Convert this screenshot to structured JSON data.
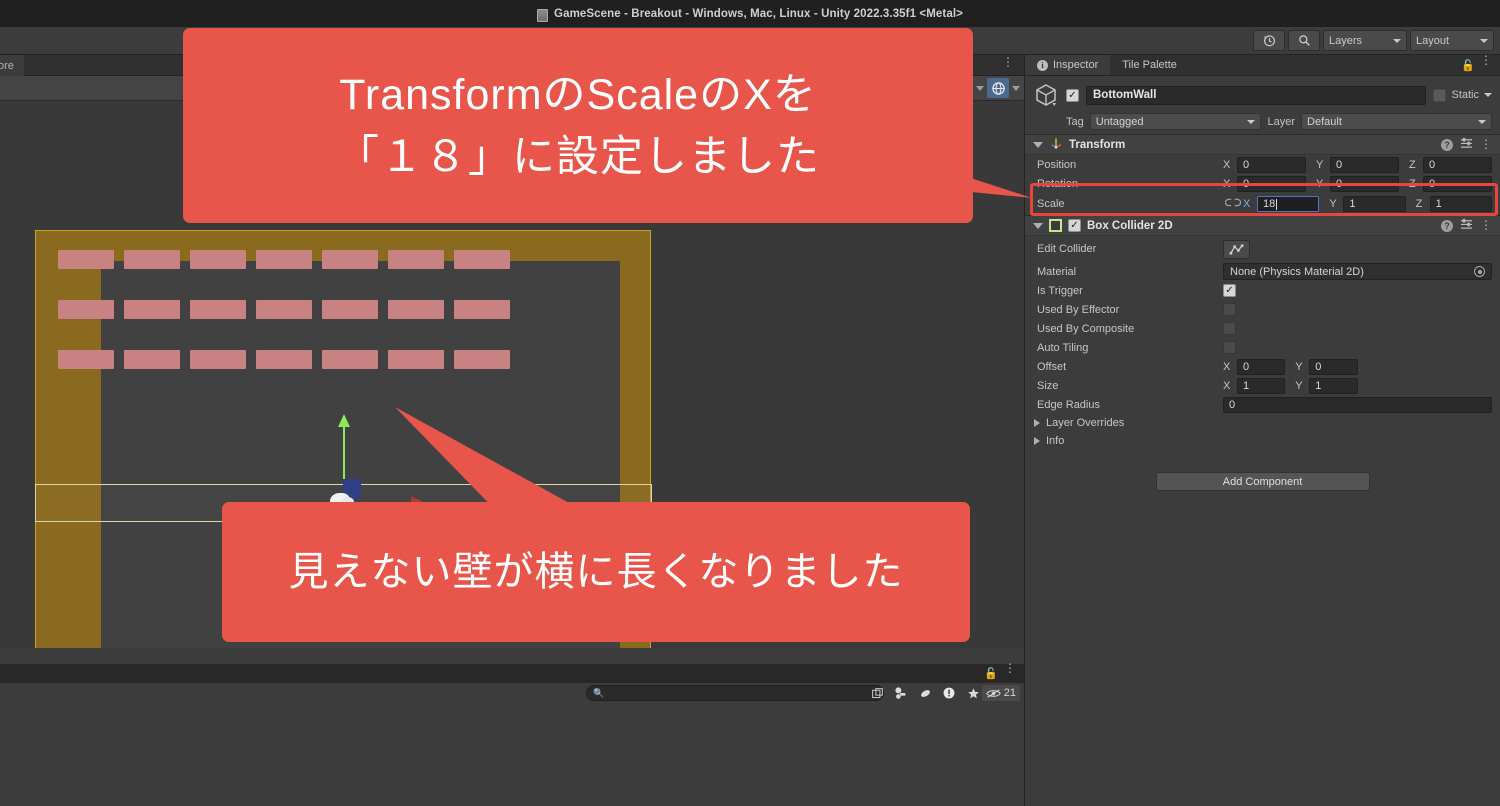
{
  "window": {
    "title": "GameScene - Breakout - Windows, Mac, Linux - Unity 2022.3.35f1 <Metal>",
    "icon": "unity-scene-icon"
  },
  "toolbar": {
    "history_icon": "history-clock-icon",
    "search_icon": "search-icon",
    "layers_label": "Layers",
    "layout_label": "Layout"
  },
  "scene": {
    "tab_partial_label": "ore",
    "kebab": "⋮",
    "pivot_icon": "globe-icon",
    "bricks_rows": 3,
    "bricks_per_row": 7,
    "selected_object_label": "BottomWall",
    "gizmo": {
      "x_axis_color": "#b03a30",
      "y_axis_color": "#8aea5a",
      "z_axis_color": "#2f3f86"
    },
    "wall_color": "#8a6a1e",
    "brick_color": "#c98282",
    "background_color": "#414141"
  },
  "project_bar": {
    "search_placeholder": "",
    "lock_icon": "lock-open-icon",
    "kebab_icon": "kebab-menu-icon",
    "tools": [
      "new-folder-icon",
      "label-icon",
      "alert-icon",
      "favorite-star-icon"
    ],
    "visibility_count": "21"
  },
  "inspector": {
    "tabs": [
      {
        "label": "Inspector",
        "icon": "info-icon",
        "active": true
      },
      {
        "label": "Tile Palette",
        "icon": "",
        "active": false
      }
    ],
    "lock_icon": "lock-open-icon",
    "kebab_icon": "kebab-menu-icon",
    "gameobject": {
      "icon": "cube-icon",
      "enabled": true,
      "name": "BottomWall",
      "static_label": "Static",
      "static_checked": false,
      "tag_label": "Tag",
      "tag_value": "Untagged",
      "layer_label": "Layer",
      "layer_value": "Default"
    },
    "transform": {
      "title": "Transform",
      "icon": "transform-axis-icon",
      "help_icon": "help-icon",
      "preset_icon": "preset-icon",
      "kebab_icon": "kebab-menu-icon",
      "rows": [
        {
          "label": "Position",
          "x": "0",
          "y": "0",
          "z": "0"
        },
        {
          "label": "Rotation",
          "x": "0",
          "y": "0",
          "z": "0"
        },
        {
          "label": "Scale",
          "x": "18",
          "y": "1",
          "z": "1",
          "link_icon": "broken-link-icon",
          "x_focused": true
        }
      ]
    },
    "box_collider_2d": {
      "title": "Box Collider 2D",
      "icon": "box-collider-2d-icon",
      "enabled": true,
      "help_icon": "help-icon",
      "preset_icon": "preset-icon",
      "kebab_icon": "kebab-menu-icon",
      "edit_collider_label": "Edit Collider",
      "edit_collider_icon": "edit-collider-icon",
      "material_label": "Material",
      "material_value": "None (Physics Material 2D)",
      "material_picker_icon": "object-picker-icon",
      "is_trigger_label": "Is Trigger",
      "is_trigger_checked": true,
      "used_by_effector_label": "Used By Effector",
      "used_by_effector_checked": false,
      "used_by_composite_label": "Used By Composite",
      "used_by_composite_checked": false,
      "auto_tiling_label": "Auto Tiling",
      "auto_tiling_checked": false,
      "offset_label": "Offset",
      "offset_x": "0",
      "offset_y": "0",
      "size_label": "Size",
      "size_x": "1",
      "size_y": "1",
      "edge_radius_label": "Edge Radius",
      "edge_radius_value": "0",
      "layer_overrides_label": "Layer Overrides",
      "info_label": "Info"
    },
    "add_component_label": "Add Component"
  },
  "callouts": [
    {
      "id": "callout1",
      "lines": [
        "TransformのScaleのXを",
        "「１８」に設定しました"
      ],
      "color": "#e8564b"
    },
    {
      "id": "callout2",
      "lines": [
        "見えない壁が横に長くなりました"
      ],
      "color": "#e8564b"
    }
  ],
  "highlight": {
    "color": "#e8453c",
    "target": "scale-row"
  }
}
